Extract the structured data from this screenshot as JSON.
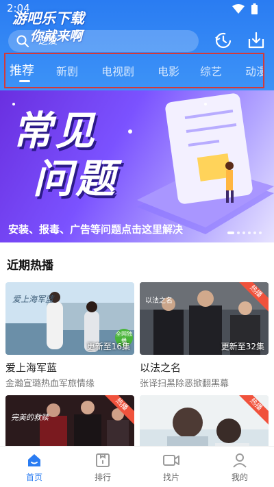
{
  "status_bar": {
    "time": "2:04"
  },
  "watermark": {
    "line1": "游吧乐下载",
    "line2": "你就来啊"
  },
  "search": {
    "value": "",
    "placeholder": "逆爱"
  },
  "header_icons": [
    "history-icon",
    "download-icon"
  ],
  "tabs": [
    {
      "label": "推荐",
      "active": true
    },
    {
      "label": "新剧"
    },
    {
      "label": "电视剧"
    },
    {
      "label": "电影"
    },
    {
      "label": "综艺"
    },
    {
      "label": "动漫"
    }
  ],
  "banner": {
    "title_line1": "常见",
    "title_line2": "问题",
    "caption": "安装、报毒、广告等问题点击这里解决",
    "slide_count": 6,
    "active_slide": 1
  },
  "section": {
    "title": "近期热播"
  },
  "cards": [
    {
      "poster_title": "爱上海军蓝",
      "title": "爱上海军蓝",
      "subtitle": "金瀚宣璐热血军旅情缘",
      "update": "更新至16集",
      "badge": "全网独播"
    },
    {
      "poster_title": "以法之名",
      "title": "以法之名",
      "subtitle": "张译扫黑除恶掀翻黑幕",
      "update": "更新至32集",
      "hot": "热播"
    },
    {
      "poster_title": "完美的救赎",
      "hot": "热播"
    },
    {
      "hot": "热播"
    }
  ],
  "bottom_nav": [
    {
      "label": "首页",
      "icon": "home-icon",
      "active": true
    },
    {
      "label": "排行",
      "icon": "ranking-icon"
    },
    {
      "label": "找片",
      "icon": "video-icon"
    },
    {
      "label": "我的",
      "icon": "user-icon"
    }
  ],
  "colors": {
    "accent": "#2a7cf2",
    "hot_badge": "#f0523c",
    "banner_purple": "#6a2fe0",
    "tab_highlight_border": "#d23a3a"
  }
}
